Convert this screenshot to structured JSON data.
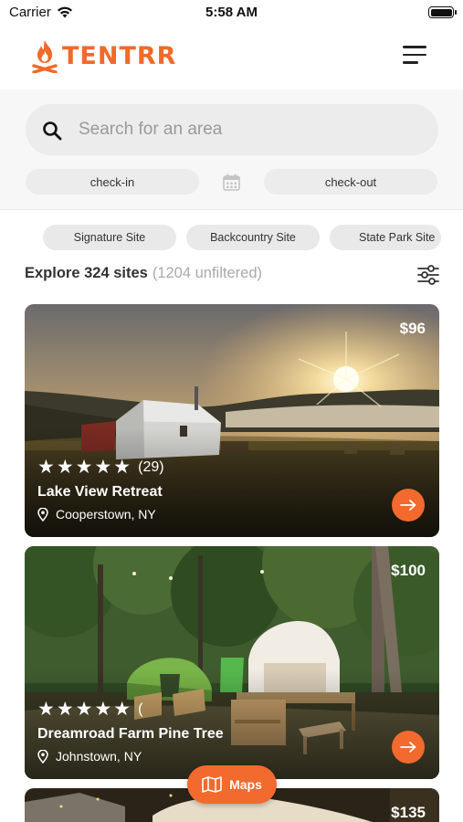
{
  "status_bar": {
    "carrier": "Carrier",
    "time": "5:58 AM"
  },
  "header": {
    "logo_text": "TENTRR",
    "menu_icon": "menu-icon"
  },
  "search": {
    "placeholder": "Search for an area",
    "checkin_label": "check-in",
    "checkout_label": "check-out"
  },
  "filters": {
    "chips": [
      "Signature Site",
      "Backcountry Site",
      "State Park Site"
    ]
  },
  "explore": {
    "main": "Explore 324 sites",
    "sub": "(1204 unfiltered)"
  },
  "cards": [
    {
      "price": "$96",
      "stars": "★★★★★",
      "reviews": "(29)",
      "name": "Lake View Retreat",
      "location": "Cooperstown, NY"
    },
    {
      "price": "$100",
      "stars": "★★★★★",
      "reviews": "(",
      "name": "Dreamroad Farm Pine Tree",
      "location": "Johnstown, NY"
    },
    {
      "price": "$135"
    }
  ],
  "maps_button": {
    "label": "Maps"
  },
  "colors": {
    "accent": "#f26a2d",
    "logo": "#f06a2a"
  }
}
